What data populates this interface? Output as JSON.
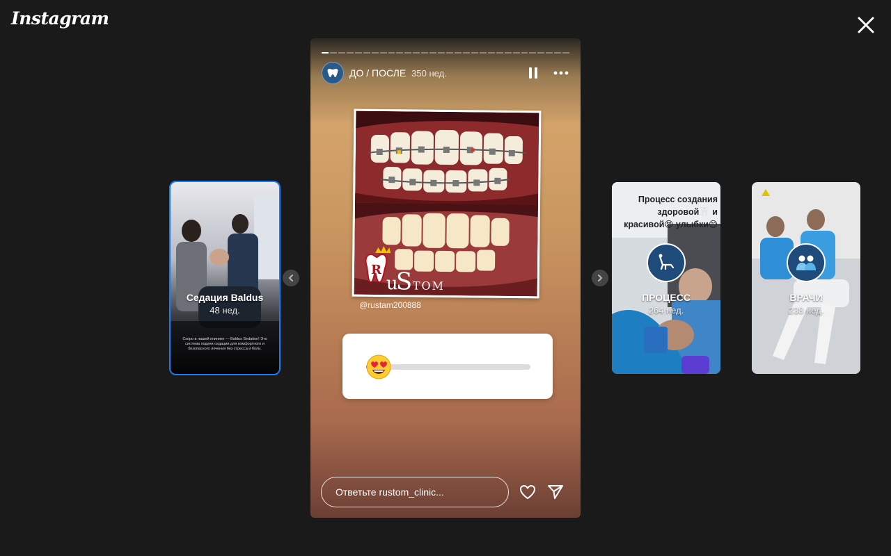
{
  "app": {
    "logo": "Instagram"
  },
  "story": {
    "author": "ДО / ПОСЛЕ",
    "age": "350 нед.",
    "progress_segments": 30,
    "progress_done": 1,
    "mention": "@rustam200888",
    "photo_watermark": "RuStom",
    "slider_value": 0.05,
    "slider_emoji": "😍",
    "reply_placeholder": "Ответьте rustom_clinic..."
  },
  "highlights_prev": {
    "title": "Седация Baldus",
    "age": "48 нед.",
    "caption": "Скоро в нашей клинике — Baldus Sedation! Это система подачи седации для комфортного и безопасного лечения без стресса и боли."
  },
  "highlights_next": [
    {
      "title": "ПРОЦЕСС",
      "age": "264 нед.",
      "overlay": [
        "Процесс создания",
        "здоровой🦷 и",
        "красивой😍 улыбки😊"
      ]
    },
    {
      "title": "ВРАЧИ",
      "age": "238 нед."
    }
  ],
  "colors": {
    "background": "#1a1a1a",
    "active_outline": "#1d7bf5",
    "slider_fill": "#8b3fd1"
  },
  "icons": {
    "close": "close-icon",
    "pause": "pause-icon",
    "more": "more-icon",
    "like": "heart-icon",
    "share": "send-icon",
    "prev": "chevron-left-icon",
    "next": "chevron-right-icon"
  }
}
